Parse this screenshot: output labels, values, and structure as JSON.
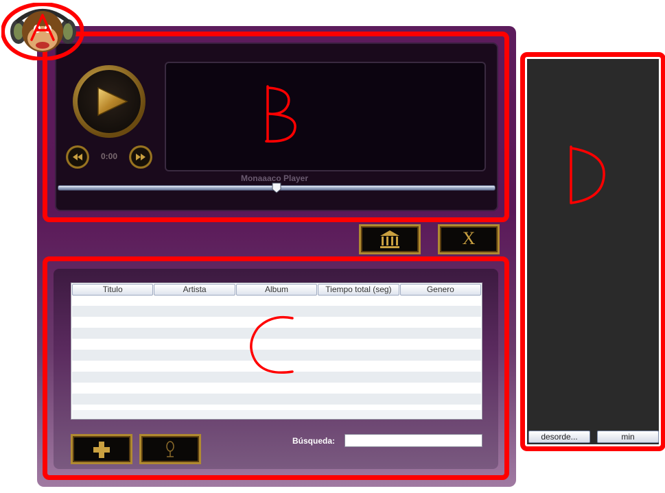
{
  "player": {
    "time": "0:00",
    "caption": "Monaaaco Player",
    "seek_fraction": 0.5
  },
  "toolbar": {
    "library_icon": "library-icon",
    "close_label": "X"
  },
  "table": {
    "columns": [
      "Titulo",
      "Artista",
      "Album",
      "Tiempo total (seg)",
      "Genero"
    ],
    "rows": []
  },
  "list_controls": {
    "add_icon": "plus-icon",
    "mic_icon": "microphone-icon",
    "search_label": "Búsqueda:",
    "search_value": ""
  },
  "side": {
    "shuffle_label": "desorde...",
    "min_label": "min"
  },
  "annotations": [
    "A",
    "B",
    "C",
    "D"
  ],
  "colors": {
    "annotation": "#ff0000",
    "window": "#5a1858",
    "gold": "#b08a30"
  }
}
